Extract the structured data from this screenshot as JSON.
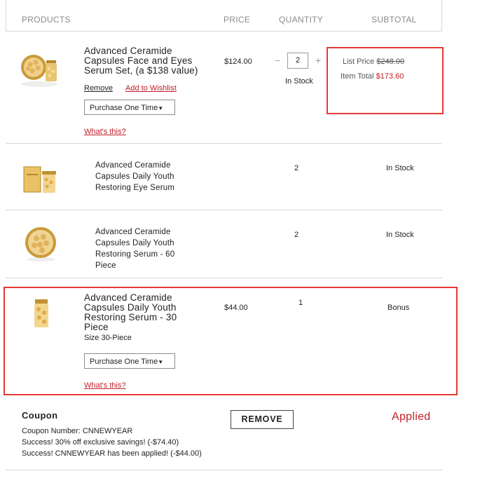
{
  "header": {
    "products": "PRODUCTS",
    "price": "PRICE",
    "quantity": "QUANTITY",
    "subtotal": "SUBTOTAL"
  },
  "item1": {
    "title": "Advanced Ceramide Capsules Face and Eyes Serum Set, (a $138 value)",
    "remove": "Remove",
    "wishlist": "Add to Wishlist",
    "purchase_option": "Purchase One Time",
    "whats_this": "What's this?",
    "price": "$124.00",
    "qty_minus": "−",
    "qty_value": "2",
    "qty_plus": "+",
    "stock": "In Stock",
    "list_price_label": "List Price",
    "list_price_value": "$248.00",
    "item_total_label": "Item Total",
    "item_total_value": "$173.60"
  },
  "item2": {
    "title": "Advanced Ceramide Capsules Daily Youth Restoring Eye Serum",
    "qty": "2",
    "stock": "In Stock"
  },
  "item3": {
    "title": "Advanced Ceramide Capsules Daily Youth Restoring Serum - 60 Piece",
    "qty": "2",
    "stock": "In Stock"
  },
  "item4": {
    "title": "Advanced Ceramide Capsules Daily Youth Restoring Serum - 30 Piece",
    "size": "Size 30-Piece",
    "purchase_option": "Purchase One Time",
    "whats_this": "What's this?",
    "price": "$44.00",
    "qty": "1",
    "status": "Bonus"
  },
  "coupon": {
    "heading": "Coupon",
    "number_line": "Coupon Number: CNNEWYEAR",
    "success1": "Success! 30% off exclusive savings! (-$74.40)",
    "success2": "Success! CNNEWYEAR has been applied! (-$44.00)",
    "remove_button": "REMOVE",
    "applied": "Applied"
  },
  "colors": {
    "accent_red": "#c0202a",
    "highlight": "#e53935",
    "gold": "#d4a64a"
  }
}
